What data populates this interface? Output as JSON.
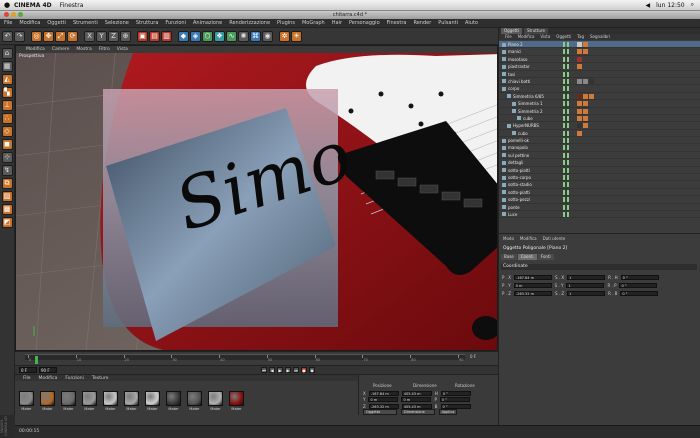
{
  "mac_menubar": {
    "app_name": "CINEMA 4D",
    "menus": [
      "Finestra"
    ],
    "clock": "lun 12:50"
  },
  "window": {
    "title": "chitarra.c4d *"
  },
  "app_menu": [
    "File",
    "Modifica",
    "Oggetti",
    "Strumenti",
    "Selezione",
    "Struttura",
    "Funzioni",
    "Animazione",
    "Renderizzazione",
    "Plugins",
    "MoGraph",
    "Hair",
    "Personaggio",
    "Finestra",
    "Render",
    "Pulsanti",
    "Aiuto"
  ],
  "viewport": {
    "menu": [
      "Modifica",
      "Camere",
      "Mostra",
      "Filtro",
      "Vista"
    ],
    "label": "Prospettiva",
    "signature_text": "Simo"
  },
  "timeline": {
    "ticks": [
      "0",
      "10",
      "20",
      "30",
      "40",
      "50",
      "60",
      "70",
      "80",
      "90"
    ],
    "end_label": "0 F"
  },
  "playback": {
    "start": "0 F",
    "end": "90 F"
  },
  "material_manager": {
    "menu": [
      "File",
      "Modifica",
      "Funzioni",
      "Texture"
    ],
    "materials": [
      {
        "name": "Mater",
        "color": "#8a8a8a"
      },
      {
        "name": "Mater",
        "color": "#b06a2a"
      },
      {
        "name": "Mater",
        "color": "#6b6b6b"
      },
      {
        "name": "Mater",
        "color": "#9a9a9a"
      },
      {
        "name": "Mater",
        "color": "#c8c8c8"
      },
      {
        "name": "Mater",
        "color": "#a8a8a8"
      },
      {
        "name": "Mater",
        "color": "#d0d0d0"
      },
      {
        "name": "Mater",
        "color": "#3a3a3a"
      },
      {
        "name": "Mater",
        "color": "#555555"
      },
      {
        "name": "Mater",
        "color": "#b0b0b0"
      },
      {
        "name": "Mater",
        "color": "#8a1010"
      }
    ]
  },
  "coord_manager": {
    "headers": [
      "Posizione",
      "Dimensione",
      "Rotazione"
    ],
    "rows": [
      {
        "axis": "X",
        "pos": "-167.84 m",
        "size": "405.43 m",
        "rot_label": "H",
        "rot": "0 °"
      },
      {
        "axis": "Y",
        "pos": "0 m",
        "size": "0 m",
        "rot_label": "P",
        "rot": "0 °"
      },
      {
        "axis": "Z",
        "pos": "-263.32 m",
        "size": "405.43 m",
        "rot_label": "B",
        "rot": "0 °"
      }
    ],
    "mode": "Oggetto",
    "size_mode": "Dimensione",
    "apply": "Applica"
  },
  "status_bar": {
    "text": "00:00:15"
  },
  "logo": "MAXON CINEMA 4D",
  "object_manager": {
    "tabs": [
      "Oggetti",
      "Strutture"
    ],
    "menu": [
      "File",
      "Modifica",
      "Vista",
      "Oggetti",
      "Tag",
      "Segnalibri"
    ],
    "objects": [
      {
        "name": "Piano 2",
        "indent": 0,
        "selected": true,
        "tags": [
          "#c8c8c8",
          "#d07a3a"
        ]
      },
      {
        "name": "manici",
        "indent": 0,
        "selected": false,
        "tags": [
          "#d07a3a",
          "#d07a3a"
        ]
      },
      {
        "name": "mosotaso",
        "indent": 0,
        "selected": false,
        "tags": [
          "#a03030"
        ]
      },
      {
        "name": "piastrastar",
        "indent": 0,
        "selected": false,
        "tags": [
          "#d07a3a"
        ]
      },
      {
        "name": "tasi",
        "indent": 0,
        "selected": false,
        "tags": []
      },
      {
        "name": "chiavi botti",
        "indent": 0,
        "selected": false,
        "tags": [
          "#888",
          "#888",
          "#333"
        ]
      },
      {
        "name": "corpo",
        "indent": 0,
        "selected": false,
        "tags": []
      },
      {
        "name": "Simmetria 6/85",
        "indent": 1,
        "selected": false,
        "tags": [
          "#6a2a1a",
          "#d07a3a",
          "#d07a3a"
        ]
      },
      {
        "name": "Simmetria 1",
        "indent": 2,
        "selected": false,
        "tags": [
          "#d07a3a",
          "#d07a3a"
        ]
      },
      {
        "name": "Simmetria 2",
        "indent": 2,
        "selected": false,
        "tags": [
          "#d07a3a",
          "#d07a3a"
        ]
      },
      {
        "name": "cube",
        "indent": 3,
        "selected": false,
        "tags": [
          "#d07a3a",
          "#d07a3a"
        ]
      },
      {
        "name": "HyperNURBS",
        "indent": 1,
        "selected": false,
        "tags": [
          "#333",
          "#d07a3a"
        ]
      },
      {
        "name": "cubo",
        "indent": 2,
        "selected": false,
        "tags": [
          "#d07a3a"
        ]
      },
      {
        "name": "pomelli-ok",
        "indent": 0,
        "selected": false,
        "tags": []
      },
      {
        "name": "manopola",
        "indent": 0,
        "selected": false,
        "tags": []
      },
      {
        "name": "sul pettine",
        "indent": 0,
        "selected": false,
        "tags": []
      },
      {
        "name": "dettagli",
        "indent": 0,
        "selected": false,
        "tags": []
      },
      {
        "name": "sotto-piatti",
        "indent": 0,
        "selected": false,
        "tags": []
      },
      {
        "name": "sotto-corpo",
        "indent": 0,
        "selected": false,
        "tags": []
      },
      {
        "name": "sotto-stadio",
        "indent": 0,
        "selected": false,
        "tags": []
      },
      {
        "name": "sotto-piatti",
        "indent": 0,
        "selected": false,
        "tags": []
      },
      {
        "name": "sotto-pezzi",
        "indent": 0,
        "selected": false,
        "tags": []
      },
      {
        "name": "ponte",
        "indent": 0,
        "selected": false,
        "tags": []
      },
      {
        "name": "Luce",
        "indent": 0,
        "selected": false,
        "tags": []
      }
    ]
  },
  "attributes_manager": {
    "menu": [
      "Modo",
      "Modifica",
      "Dati utente"
    ],
    "title": "Oggetto Poligonale [Piano 2]",
    "tabs": [
      "Base",
      "Coord.",
      "Fonti"
    ],
    "section": "Coordinate",
    "rows": [
      {
        "l1": "P . X",
        "v1": "-167.84 m",
        "l2": "S . X",
        "v2": "1",
        "l3": "R . H",
        "v3": "0 °"
      },
      {
        "l1": "P . Y",
        "v1": "0 m",
        "l2": "S . Y",
        "v2": "1",
        "l3": "R . P",
        "v3": "0 °"
      },
      {
        "l1": "P . Z",
        "v1": "-263.32 m",
        "l2": "S . Z",
        "v2": "1",
        "l3": "R . B",
        "v3": "0 °"
      }
    ]
  },
  "colors": {
    "guitar_body": "#8e0e12",
    "pickguard": "#f2f2f2",
    "bridge": "#111111",
    "selection": "#4f6a8a",
    "accent": "#c9722a"
  }
}
